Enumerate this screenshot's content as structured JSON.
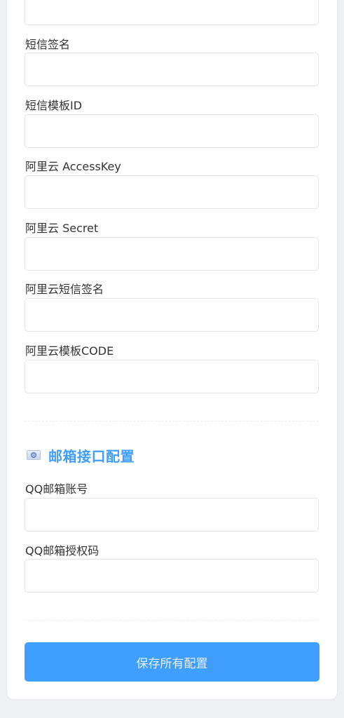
{
  "sms_fields": [
    {
      "label": "短信签名",
      "value": ""
    },
    {
      "label": "短信模板ID",
      "value": ""
    },
    {
      "label": "阿里云 AccessKey",
      "value": ""
    },
    {
      "label": "阿里云 Secret",
      "value": ""
    },
    {
      "label": "阿里云短信签名",
      "value": ""
    },
    {
      "label": "阿里云模板CODE",
      "value": ""
    }
  ],
  "email_section": {
    "icon": "email-icon",
    "title": "邮箱接口配置",
    "title_color": "#409eff"
  },
  "email_fields": [
    {
      "label": "QQ邮箱账号",
      "value": ""
    },
    {
      "label": "QQ邮箱授权码",
      "value": ""
    }
  ],
  "actions": {
    "save_label": "保存所有配置",
    "save_color": "#409eff"
  }
}
